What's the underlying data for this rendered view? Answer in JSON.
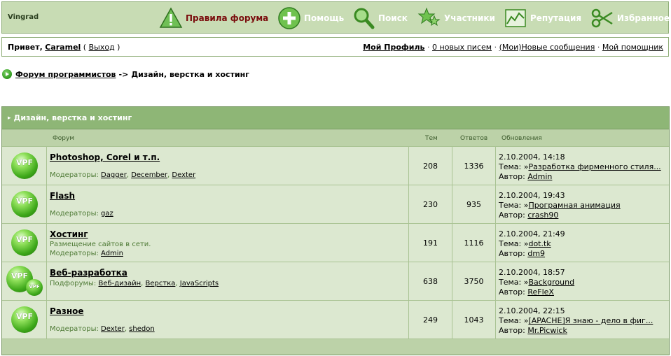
{
  "header": {
    "logo": "Vingrad",
    "nav": [
      {
        "label": "Правила форума",
        "icon": "warning-icon",
        "active": true
      },
      {
        "label": "Помощь",
        "icon": "plus-icon"
      },
      {
        "label": "Поиск",
        "icon": "search-icon"
      },
      {
        "label": "Участники",
        "icon": "stars-icon"
      },
      {
        "label": "Репутация",
        "icon": "chart-icon"
      },
      {
        "label": "Избранное",
        "icon": "scissors-icon"
      }
    ]
  },
  "userbar": {
    "greeting": "Привет,",
    "username": "Caramel",
    "logout": "Выход",
    "profile": "Мой Профиль",
    "messages": "0 новых писем",
    "my_prefix": "(Мои)",
    "new_posts": "Новые сообщения",
    "assistant": "Мой помощник"
  },
  "breadcrumb": {
    "parent": "Форум программистов",
    "separator": "->",
    "current": "Дизайн, верстка и хостинг"
  },
  "forum": {
    "category": "Дизайн, верстка и хостинг",
    "columns": {
      "forum": "Форум",
      "topics": "Тем",
      "replies": "Ответов",
      "updates": "Обновления"
    },
    "icon_label": "VPF",
    "rows": [
      {
        "name": "Photoshop, Corel и т.п.",
        "desc": "",
        "mods_label": "Модераторы:",
        "mods": [
          "Dagger",
          "December",
          "Dexter"
        ],
        "topics": "208",
        "replies": "1336",
        "date": "2.10.2004, 14:18",
        "topic_label": "Тема:",
        "topic": "Разработка фирменного стиля...",
        "author_label": "Автор:",
        "author": "Admin"
      },
      {
        "name": "Flash",
        "desc": "",
        "mods_label": "Модераторы:",
        "mods": [
          "gaz"
        ],
        "topics": "230",
        "replies": "935",
        "date": "2.10.2004, 19:43",
        "topic_label": "Тема:",
        "topic": "Програмная анимация",
        "author_label": "Автор:",
        "author": "crash90"
      },
      {
        "name": "Хостинг",
        "desc": "Размещение сайтов в сети.",
        "mods_label": "Модераторы:",
        "mods": [
          "Admin"
        ],
        "topics": "191",
        "replies": "1116",
        "date": "2.10.2004, 21:49",
        "topic_label": "Тема:",
        "topic": "dot.tk",
        "author_label": "Автор:",
        "author": "dm9"
      },
      {
        "name": "Веб-разработка",
        "desc": "",
        "mods_label": "Подфорумы:",
        "mods": [
          "Веб-дизайн",
          "Верстка",
          "JavaScripts"
        ],
        "topics": "638",
        "replies": "3750",
        "date": "2.10.2004, 18:57",
        "topic_label": "Тема:",
        "topic": "Background",
        "author_label": "Автор:",
        "author": "ReFleX"
      },
      {
        "name": "Разное",
        "desc": "",
        "mods_label": "Модераторы:",
        "mods": [
          "Dexter",
          "shedon"
        ],
        "topics": "249",
        "replies": "1043",
        "date": "2.10.2004, 22:15",
        "topic_label": "Тема:",
        "topic": "[APACHE]Я знаю - дело в фиг...",
        "author_label": "Автор:",
        "author": "Mr.Picwick"
      }
    ]
  }
}
